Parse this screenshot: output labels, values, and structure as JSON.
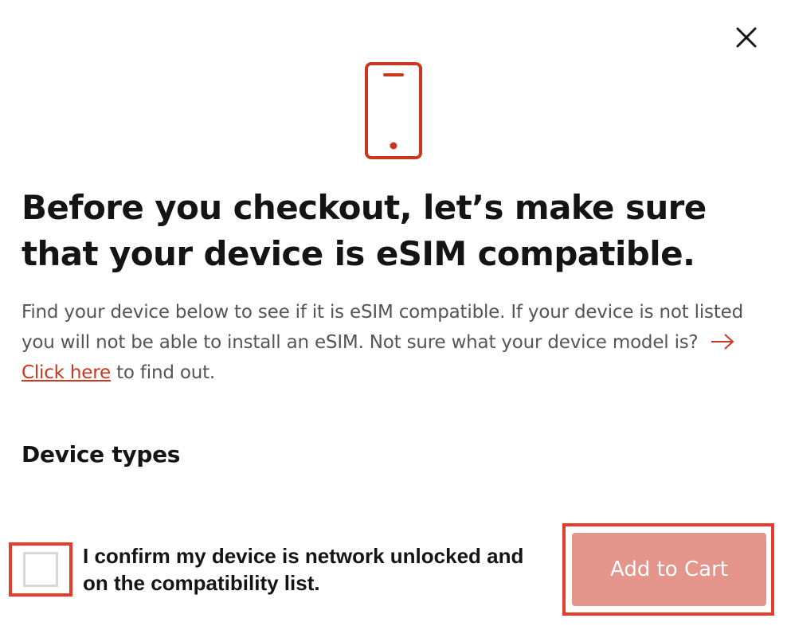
{
  "modal": {
    "close_icon": "close-icon",
    "device_icon": "smartphone-icon",
    "title": "Before you checkout, let’s make sure that your device is eSIM compatible.",
    "description": {
      "text_before_link": "Find your device below to see if it is eSIM compatible. If your device is not listed you will not be able to install an eSIM. Not sure what your device model is?",
      "arrow_icon": "arrow-right-icon",
      "link_label": "Click here",
      "text_after_link": " to find out."
    },
    "section_title": "Device types",
    "confirm": {
      "label": "I confirm my device is network unlocked and on the compatibility list.",
      "checked": false
    },
    "add_to_cart_label": "Add to Cart"
  },
  "colors": {
    "accent": "#c8371f",
    "highlight_border": "#e43d2c",
    "button_disabled_bg": "#e4968c",
    "title_text": "#141414",
    "body_text": "#555555"
  }
}
